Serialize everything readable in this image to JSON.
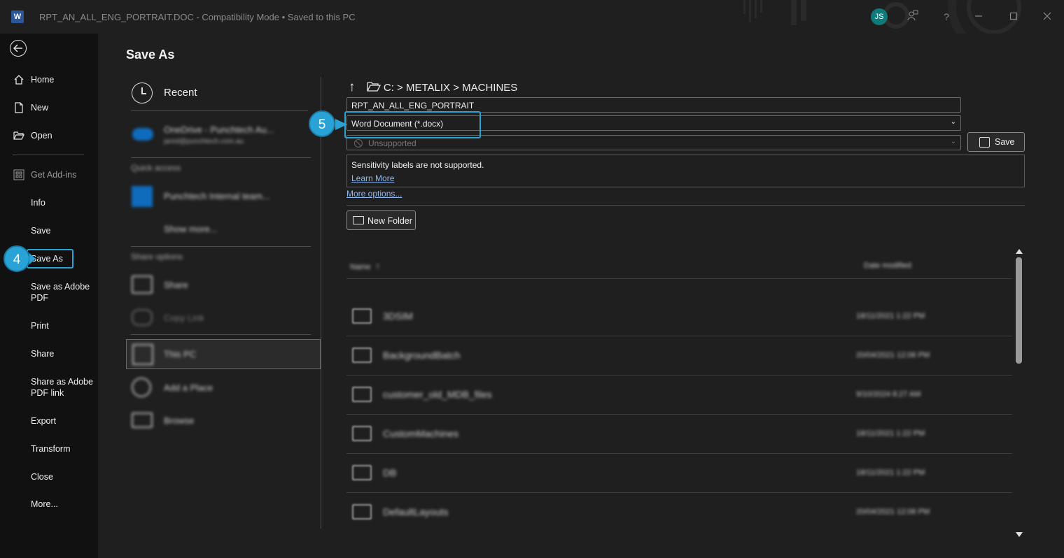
{
  "titlebar": {
    "app_icon_letter": "W",
    "doc_name": "RPT_AN_ALL_ENG_PORTRAIT.DOC",
    "mode": "Compatibility Mode",
    "saved_state": "Saved to this PC",
    "avatar_initials": "JS",
    "help_glyph": "?"
  },
  "nav": {
    "items": [
      {
        "label": "Home",
        "icon": "home-icon"
      },
      {
        "label": "New",
        "icon": "new-doc-icon"
      },
      {
        "label": "Open",
        "icon": "open-folder-icon"
      },
      {
        "label": "Get Add-ins",
        "icon": "addins-icon"
      },
      {
        "label": "Info"
      },
      {
        "label": "Save"
      },
      {
        "label": "Save As"
      },
      {
        "label": "Save as Adobe PDF"
      },
      {
        "label": "Print"
      },
      {
        "label": "Share"
      },
      {
        "label": "Share as Adobe PDF link"
      },
      {
        "label": "Export"
      },
      {
        "label": "Transform"
      },
      {
        "label": "Close"
      },
      {
        "label": "More..."
      }
    ]
  },
  "page_title": "Save As",
  "locations": {
    "recent": "Recent",
    "onedrive_name": "OneDrive - Punchtech Au...",
    "onedrive_email": "jared@punchtech.com.au",
    "quick_access": "Quick access",
    "team": "Punchtech Internal team...",
    "show_more": "Show more...",
    "share_options": "Share options",
    "share": "Share",
    "copy_link": "Copy Link",
    "this_pc": "This PC",
    "add_place": "Add a Place",
    "browse": "Browse"
  },
  "path": {
    "up_glyph": "↑",
    "drive": "C:",
    "folder1": "METALIX",
    "folder2": "MACHINES",
    "separator": ">"
  },
  "form": {
    "filename": "RPT_AN_ALL_ENG_PORTRAIT",
    "filetype": "Word Document (*.docx)",
    "sensitivity": "Unsupported",
    "save_label": "Save",
    "sensitivity_msg": "Sensitivity labels are not supported.",
    "learn_more": "Learn More",
    "more_options": "More options...",
    "new_folder": "New Folder"
  },
  "files": {
    "headers": {
      "name": "Name",
      "sort_glyph": "↑",
      "date": "Date modified"
    },
    "rows": [
      {
        "name": "3DSIM",
        "date": "18/11/2021 1:22 PM"
      },
      {
        "name": "BackgroundBatch",
        "date": "20/04/2021 12:06 PM"
      },
      {
        "name": "customer_old_MDB_files",
        "date": "9/10/2024 8:27 AM"
      },
      {
        "name": "CustomMachines",
        "date": "18/11/2021 1:22 PM"
      },
      {
        "name": "DB",
        "date": "18/11/2021 1:22 PM"
      },
      {
        "name": "DefaultLayouts",
        "date": "20/04/2021 12:06 PM"
      }
    ]
  },
  "callouts": {
    "step4": "4",
    "step5": "5"
  },
  "colors": {
    "accent": "#29a3d6",
    "nav_bg": "#111111",
    "main_bg": "#1f1f1f",
    "word_blue": "#2b579a"
  }
}
